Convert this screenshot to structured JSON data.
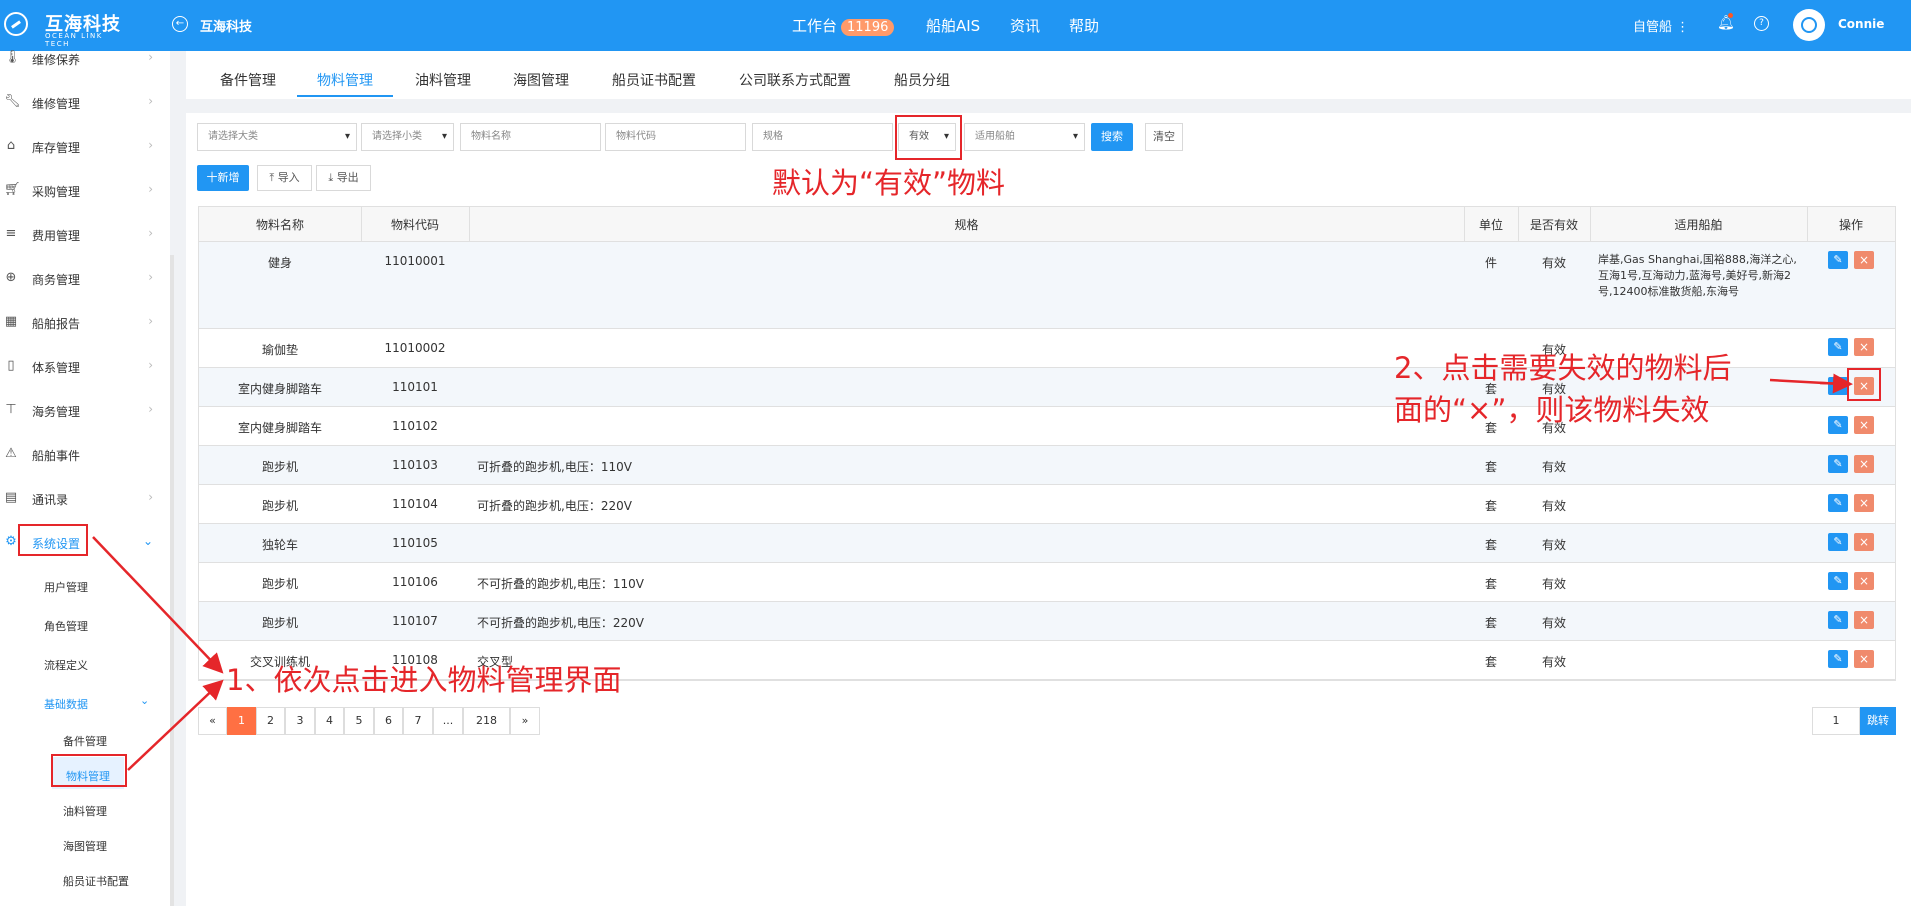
{
  "header": {
    "logo_cn": "互海科技",
    "logo_en": "OCEAN LINK TECH",
    "company": "互海科技",
    "nav": [
      "工作台",
      "船舶AIS",
      "资讯",
      "帮助"
    ],
    "workbench_badge": "11196",
    "mgmt_label": "自管船",
    "username": "Connie"
  },
  "sidebar": {
    "items": [
      {
        "label": "维修保养",
        "icon": "thermometer-icon"
      },
      {
        "label": "维修管理",
        "icon": "wrench-icon"
      },
      {
        "label": "库存管理",
        "icon": "home-icon"
      },
      {
        "label": "采购管理",
        "icon": "cart-icon"
      },
      {
        "label": "费用管理",
        "icon": "database-icon"
      },
      {
        "label": "商务管理",
        "icon": "globe-icon"
      },
      {
        "label": "船舶报告",
        "icon": "calendar-icon"
      },
      {
        "label": "体系管理",
        "icon": "document-icon"
      },
      {
        "label": "海务管理",
        "icon": "signpost-icon"
      },
      {
        "label": "船舶事件",
        "icon": "warning-icon"
      },
      {
        "label": "通讯录",
        "icon": "contacts-icon"
      },
      {
        "label": "系统设置",
        "icon": "gear-icon"
      }
    ],
    "sub_items": [
      "用户管理",
      "角色管理",
      "流程定义",
      "基础数据"
    ],
    "sub_sub_items": [
      "备件管理",
      "物料管理",
      "油料管理",
      "海图管理",
      "船员证书配置"
    ]
  },
  "tabs": [
    "备件管理",
    "物料管理",
    "油料管理",
    "海图管理",
    "船员证书配置",
    "公司联系方式配置",
    "船员分组"
  ],
  "filters": {
    "category": "请选择大类",
    "subcategory": "请选择小类",
    "name": "物料名称",
    "code": "物料代码",
    "spec": "规格",
    "validity": "有效",
    "vessel": "适用船舶",
    "search": "搜索",
    "clear": "清空"
  },
  "actions": {
    "add": "十新增",
    "import": "导入",
    "export": "导出"
  },
  "table": {
    "headers": [
      "物料名称",
      "物料代码",
      "规格",
      "单位",
      "是否有效",
      "适用船舶",
      "操作"
    ],
    "rows": [
      {
        "name": "健身",
        "code": "11010001",
        "spec": "",
        "unit": "件",
        "valid": "有效",
        "vessels": "岸基,Gas Shanghai,国裕888,海洋之心,互海1号,互海动力,蓝海号,美好号,新海2号,12400标准散货船,东海号"
      },
      {
        "name": "瑜伽垫",
        "code": "11010002",
        "spec": "",
        "unit": "",
        "valid": "有效",
        "vessels": ""
      },
      {
        "name": "室内健身脚踏车",
        "code": "110101",
        "spec": "",
        "unit": "套",
        "valid": "有效",
        "vessels": ""
      },
      {
        "name": "室内健身脚踏车",
        "code": "110102",
        "spec": "",
        "unit": "套",
        "valid": "有效",
        "vessels": ""
      },
      {
        "name": "跑步机",
        "code": "110103",
        "spec": "可折叠的跑步机,电压：110V",
        "unit": "套",
        "valid": "有效",
        "vessels": ""
      },
      {
        "name": "跑步机",
        "code": "110104",
        "spec": "可折叠的跑步机,电压：220V",
        "unit": "套",
        "valid": "有效",
        "vessels": ""
      },
      {
        "name": "独轮车",
        "code": "110105",
        "spec": "",
        "unit": "套",
        "valid": "有效",
        "vessels": ""
      },
      {
        "name": "跑步机",
        "code": "110106",
        "spec": "不可折叠的跑步机,电压：110V",
        "unit": "套",
        "valid": "有效",
        "vessels": ""
      },
      {
        "name": "跑步机",
        "code": "110107",
        "spec": "不可折叠的跑步机,电压：220V",
        "unit": "套",
        "valid": "有效",
        "vessels": ""
      },
      {
        "name": "交叉训练机",
        "code": "110108",
        "spec": "交叉型",
        "unit": "套",
        "valid": "有效",
        "vessels": ""
      }
    ]
  },
  "pagination": {
    "prev": "«",
    "pages": [
      "1",
      "2",
      "3",
      "4",
      "5",
      "6",
      "7",
      "...",
      "218"
    ],
    "next": "»",
    "jump_value": "1",
    "jump_label": "跳转"
  },
  "annotations": {
    "default_note": "默认为“有效”物料",
    "step1": "1、依次点击进入物料管理界面",
    "step2_line1": "2、点击需要失效的物料后",
    "step2_line2": "面的“×”，则该物料失效"
  },
  "colors": {
    "primary": "#2196f3",
    "annotation": "#e5262a",
    "delete": "#f08a6c",
    "active_page": "#ff7043"
  }
}
